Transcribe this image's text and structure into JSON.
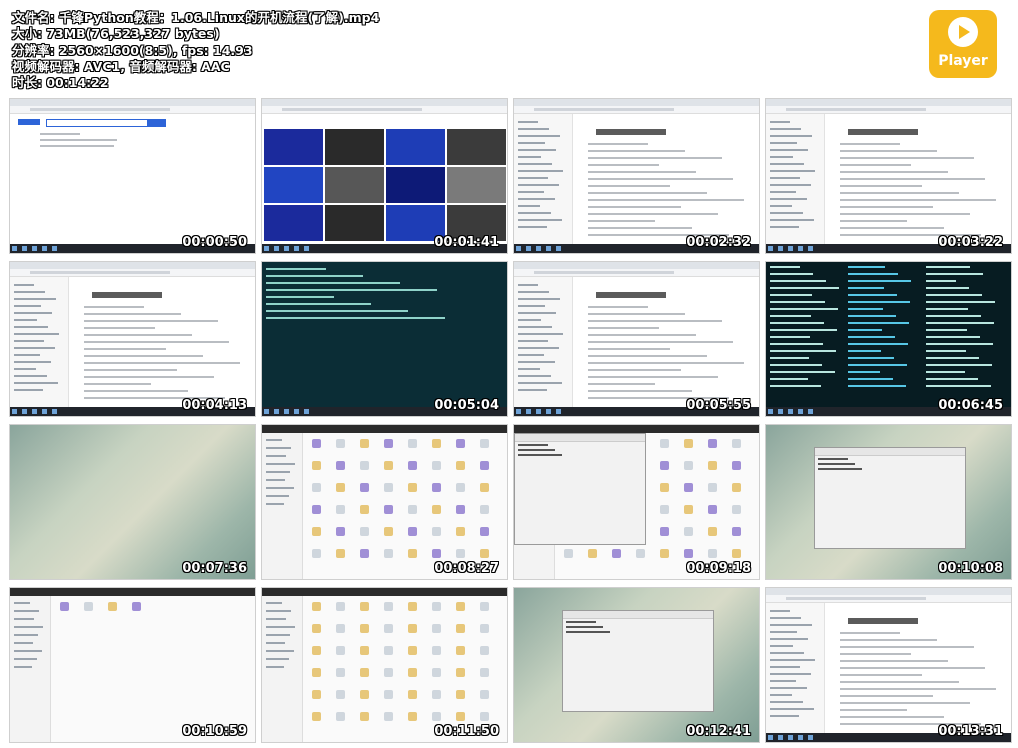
{
  "info": {
    "filename": "文件名: 千锋Python教程：1.06.Linux的开机流程(了解).mp4",
    "size": "大小: 73MB(76,523,327 bytes)",
    "resolution": "分辨率: 2560×1600(8:5), fps: 14.93",
    "video_codec": "视频解码器: AVC1, 音频解码器: AAC",
    "duration": "时长: 00:14:22"
  },
  "logo": {
    "label": "Player",
    "icon": "play-icon",
    "color": "#f5b91c"
  },
  "thumbnails": [
    {
      "time": "00:00:50",
      "kind": "browser-search"
    },
    {
      "time": "00:01:41",
      "kind": "image-search"
    },
    {
      "time": "00:02:32",
      "kind": "doc"
    },
    {
      "time": "00:03:22",
      "kind": "doc"
    },
    {
      "time": "00:04:13",
      "kind": "doc"
    },
    {
      "time": "00:05:04",
      "kind": "terminal"
    },
    {
      "time": "00:05:55",
      "kind": "doc"
    },
    {
      "time": "00:06:45",
      "kind": "terminal-ps"
    },
    {
      "time": "00:07:36",
      "kind": "desktop"
    },
    {
      "time": "00:08:27",
      "kind": "file-manager"
    },
    {
      "time": "00:09:18",
      "kind": "file-manager-terminal"
    },
    {
      "time": "00:10:08",
      "kind": "desktop-terminal"
    },
    {
      "time": "00:10:59",
      "kind": "file-manager-few"
    },
    {
      "time": "00:11:50",
      "kind": "file-manager-folders"
    },
    {
      "time": "00:12:41",
      "kind": "desktop-terminal"
    },
    {
      "time": "00:13:31",
      "kind": "doc"
    }
  ]
}
